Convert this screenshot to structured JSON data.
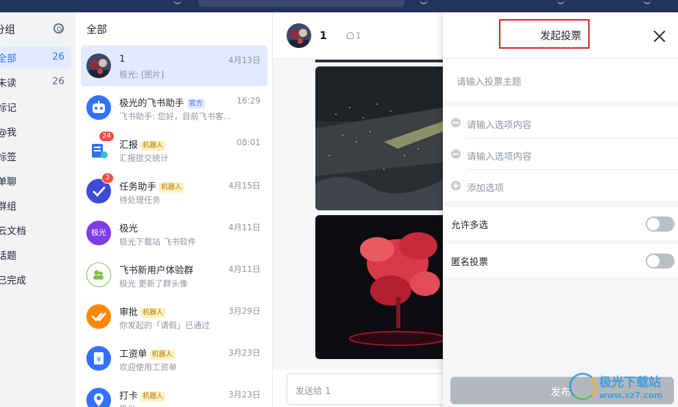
{
  "groups": {
    "title": "分组",
    "items": [
      {
        "label": "全部",
        "count": "26"
      },
      {
        "label": "未读",
        "count": "26"
      },
      {
        "label": "标记",
        "count": ""
      },
      {
        "label": "@我",
        "count": ""
      },
      {
        "label": "标签",
        "count": ""
      },
      {
        "label": "单聊",
        "count": ""
      },
      {
        "label": "群组",
        "count": ""
      },
      {
        "label": "云文档",
        "count": ""
      },
      {
        "label": "话题",
        "count": ""
      },
      {
        "label": "已完成",
        "count": ""
      }
    ]
  },
  "chatlist": {
    "title": "全部",
    "items": [
      {
        "name": "1",
        "tag": "",
        "time": "4月13日",
        "preview": "极光: [图片]",
        "badge": ""
      },
      {
        "name": "极光的飞书助手",
        "tag": "官方",
        "time": "16:29",
        "preview": "飞书助手: 您好，目前飞书客...",
        "badge": ""
      },
      {
        "name": "汇报",
        "tag": "机器人",
        "time": "08:01",
        "preview": "汇报提交统计",
        "badge": "24"
      },
      {
        "name": "任务助手",
        "tag": "机器人",
        "time": "4月15日",
        "preview": "待处理任务",
        "badge": "2"
      },
      {
        "name": "极光",
        "tag": "",
        "time": "4月11日",
        "preview": "极光下载站 飞书软件",
        "badge": "",
        "avatar_text": "极光"
      },
      {
        "name": "飞书新用户体验群",
        "tag": "",
        "time": "4月11日",
        "preview": "极光 更新了群头像",
        "badge": ""
      },
      {
        "name": "审批",
        "tag": "机器人",
        "time": "3月29日",
        "preview": "你发起的「请假」已通过",
        "badge": ""
      },
      {
        "name": "工资单",
        "tag": "机器人",
        "time": "3月23日",
        "preview": "欢迎使用工资单",
        "badge": ""
      },
      {
        "name": "打卡",
        "tag": "机器人",
        "time": "3月23日",
        "preview": "极光",
        "badge": ""
      }
    ]
  },
  "conversation": {
    "title": "1",
    "member_count": "1",
    "input_placeholder": "发送给 1"
  },
  "vote_panel": {
    "title": "发起投票",
    "topic_placeholder": "请输入投票主题",
    "option_placeholders": [
      "请输入选项内容",
      "请输入选项内容"
    ],
    "add_option_label": "添加选项",
    "allow_multiple_label": "允许多选",
    "allow_multiple_on": false,
    "anonymous_label": "匿名投票",
    "anonymous_on": false,
    "submit_label": "发布"
  },
  "watermark": {
    "text": "极光下载站",
    "url": "www.xz7.com"
  },
  "colors": {
    "accent": "#3370ff",
    "highlight_box": "#d81e1e",
    "bot_tag_bg": "#fdf0c2",
    "badge": "#f54a45"
  },
  "icons": [
    "settings-gear-icon",
    "close-icon",
    "remove-option-icon",
    "add-option-icon",
    "members-icon"
  ]
}
